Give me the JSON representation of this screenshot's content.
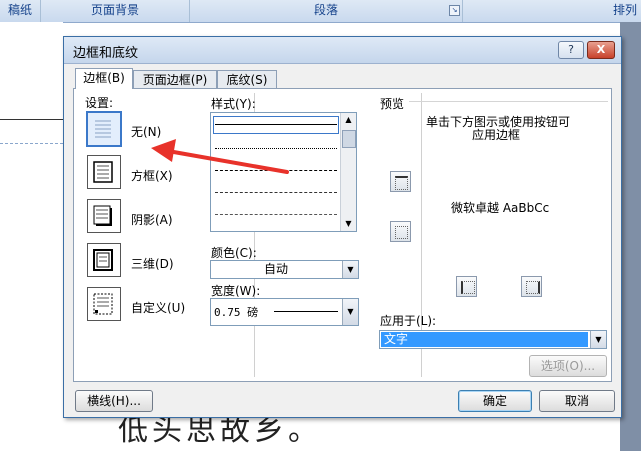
{
  "ribbon": {
    "groups": [
      "稿纸",
      "页面背景",
      "段落",
      "排列"
    ]
  },
  "document": {
    "body_text": "低头思故乡。"
  },
  "dialog": {
    "title": "边框和底纹",
    "help_label": "?",
    "close_label": "X",
    "tabs": [
      "边框(B)",
      "页面边框(P)",
      "底纹(S)"
    ],
    "settings_label": "设置:",
    "settings": [
      "无(N)",
      "方框(X)",
      "阴影(A)",
      "三维(D)",
      "自定义(U)"
    ],
    "style_label": "样式(Y):",
    "color_label": "颜色(C):",
    "color_value": "自动",
    "width_label": "宽度(W):",
    "width_value": "0.75 磅",
    "preview_label": "预览",
    "preview_hint_line1": "单击下方图示或使用按钮可",
    "preview_hint_line2": "应用边框",
    "preview_sample": "微软卓越 AaBbCc",
    "apply_to_label": "应用于(L):",
    "apply_to_value": "文字",
    "options_button": "选项(O)...",
    "horizontal_line_button": "横线(H)...",
    "ok_button": "确定",
    "cancel_button": "取消"
  },
  "colors": {
    "accent": "#3b78c9",
    "arrow": "#e8322a",
    "selection": "#3399ff"
  }
}
